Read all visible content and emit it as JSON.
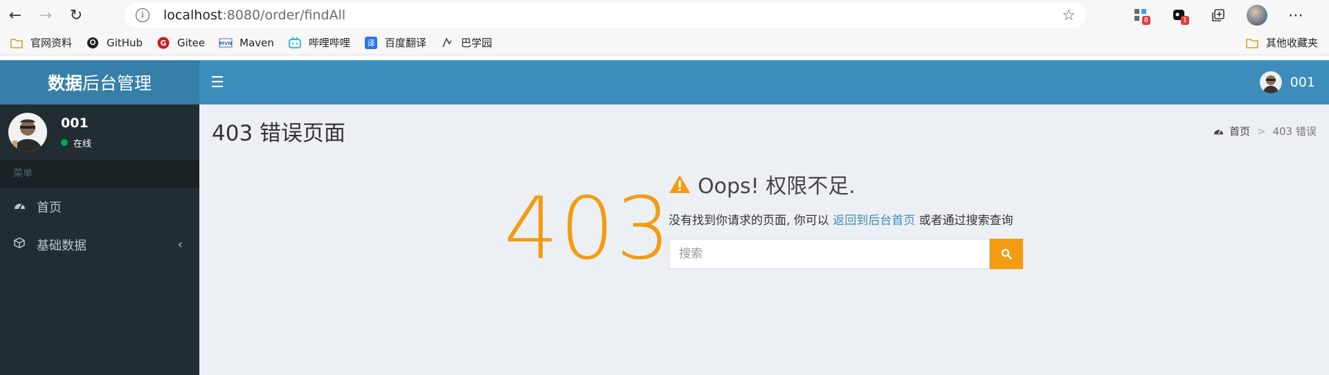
{
  "browser": {
    "url_host": "localhost",
    "url_path": ":8080/order/findAll",
    "extensions": [
      {
        "name": "collections-extension",
        "badge": "8"
      },
      {
        "name": "notes-extension",
        "badge": "1"
      }
    ]
  },
  "bookmarks": {
    "items": [
      {
        "label": "官网资料"
      },
      {
        "label": "GitHub"
      },
      {
        "label": "Gitee"
      },
      {
        "label": "Maven"
      },
      {
        "label": "哔哩哔哩"
      },
      {
        "label": "百度翻译"
      },
      {
        "label": "巴学园"
      }
    ],
    "other": "其他收藏夹"
  },
  "header": {
    "logo_bold": "数据",
    "logo_rest": "后台管理",
    "user": "001"
  },
  "sidebar": {
    "user_name": "001",
    "status": "在线",
    "menu_header": "菜单",
    "items": [
      {
        "label": "首页"
      },
      {
        "label": "基础数据"
      }
    ]
  },
  "content": {
    "page_title": "403 错误页面",
    "breadcrumb_home": "首页",
    "breadcrumb_sep": ">",
    "breadcrumb_current": "403 错误",
    "error_code": "403",
    "error_title": "Oops! 权限不足.",
    "desc_prefix": "没有找到你请求的页面, 你可以 ",
    "desc_link": "返回到后台首页",
    "desc_suffix": " 或者通过搜索查询",
    "search_placeholder": "搜索"
  },
  "colors": {
    "primary": "#3c8dbc",
    "warning": "#f39c12",
    "sidebar": "#222d32"
  }
}
